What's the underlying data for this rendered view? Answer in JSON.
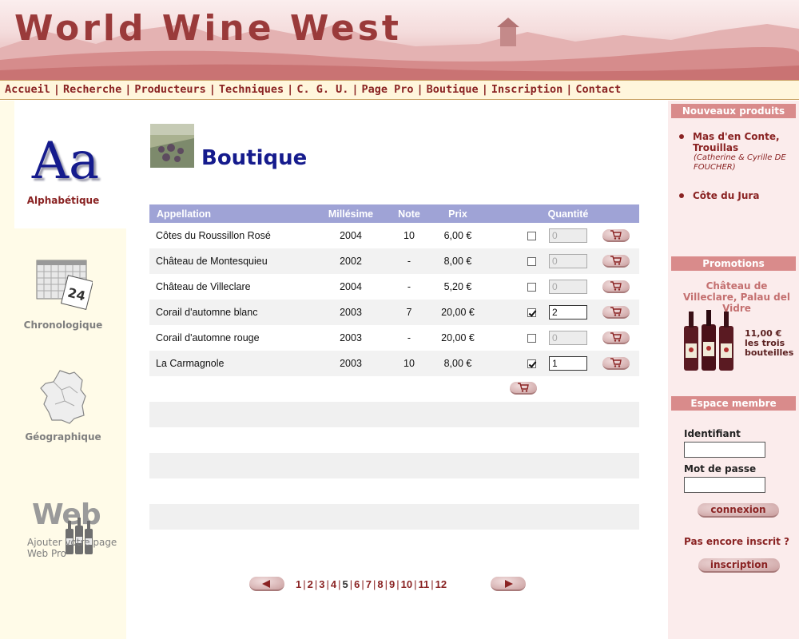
{
  "header": {
    "site_title": "World Wine West"
  },
  "nav": {
    "items": [
      "Accueil",
      "Recherche",
      "Producteurs",
      "Techniques",
      "C. G. U.",
      "Page Pro",
      "Boutique",
      "Inscription",
      "Contact"
    ]
  },
  "sidebar_left": {
    "alpha": {
      "glyph": "Aa",
      "label": "Alphabétique"
    },
    "chrono": {
      "label": "Chronologique",
      "calendar_day": "24"
    },
    "geo": {
      "label": "Géographique"
    },
    "webpro": {
      "word": "Web",
      "text": "Ajouter votre page Web Pro"
    }
  },
  "main": {
    "heading": "Boutique",
    "table": {
      "headers": [
        "Appellation",
        "Millésime",
        "Note",
        "Prix",
        "",
        "Quantité",
        ""
      ],
      "rows": [
        {
          "appellation": "Côtes du Roussillon Rosé",
          "millesime": "2004",
          "note": "10",
          "prix": "6,00 €",
          "checked": false,
          "quantite": "0"
        },
        {
          "appellation": "Château de Montesquieu",
          "millesime": "2002",
          "note": "-",
          "prix": "8,00 €",
          "checked": false,
          "quantite": "0"
        },
        {
          "appellation": "Château de Villeclare",
          "millesime": "2004",
          "note": "-",
          "prix": "5,20 €",
          "checked": false,
          "quantite": "0"
        },
        {
          "appellation": "Corail d'automne blanc",
          "millesime": "2003",
          "note": "7",
          "prix": "20,00 €",
          "checked": true,
          "quantite": "2"
        },
        {
          "appellation": "Corail d'automne rouge",
          "millesime": "2003",
          "note": "-",
          "prix": "20,00 €",
          "checked": false,
          "quantite": "0"
        },
        {
          "appellation": "La Carmagnole",
          "millesime": "2003",
          "note": "10",
          "prix": "8,00 €",
          "checked": true,
          "quantite": "1"
        }
      ]
    },
    "pagination": {
      "pages": [
        "1",
        "2",
        "3",
        "4",
        "5",
        "6",
        "7",
        "8",
        "9",
        "10",
        "11",
        "12"
      ],
      "current": "5"
    }
  },
  "sidebar_right": {
    "new_products": {
      "title": "Nouveaux produits",
      "items": [
        {
          "name": "Mas d'en Conte, Trouillas",
          "sub": "(Catherine & Cyrille DE FOUCHER)"
        },
        {
          "name": "Côte du Jura",
          "sub": ""
        }
      ]
    },
    "promotions": {
      "title": "Promotions",
      "product": "Château de Villeclare, Palau del Vidre",
      "price": "11,00 €",
      "price_note": "les trois bouteilles"
    },
    "member": {
      "title": "Espace membre",
      "login_label": "Identifiant",
      "password_label": "Mot de passe",
      "connect_button": "connexion",
      "not_registered": "Pas encore inscrit ?",
      "register_button": "inscription"
    }
  },
  "colors": {
    "brand_red": "#8a2323",
    "heading_blue": "#151b8d",
    "table_header": "#9fa3d6",
    "bar_pink": "#d98b8b"
  }
}
